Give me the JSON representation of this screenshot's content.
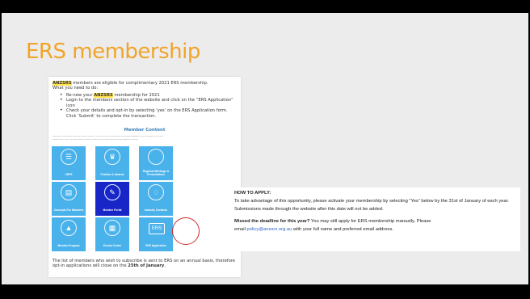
{
  "slide": {
    "title": "ERS membership"
  },
  "embedded": {
    "intro_org": "ANZSRS",
    "intro_rest": " members are eligible for complimentary 2021 ERS membership.",
    "intro_line2": "What you need to do:",
    "bullets": [
      {
        "pre": "Re-new your ",
        "org": "ANZSRS",
        "post": " membership for 2021"
      },
      {
        "text": "Login to the members section of the website and click on the “ERS Application” icon"
      },
      {
        "text": "Check your details and opt-in by selecting ‘yes’ on the ERS Application form. Click ‘Submit’ to complete the transaction."
      }
    ],
    "member_content_title": "Member Content",
    "member_content_lines": [
      "Welcome to the ANZSRS Member Content section. Here you will find resources and information available only to members of ANZSRS.",
      "Please click on one of the tiles below to access member-only content and services provided by ANZSRS."
    ],
    "tiles": [
      {
        "label": "CRFS",
        "icon": "document-icon",
        "glyph": "☰"
      },
      {
        "label": "Position & Awards",
        "icon": "award-icon",
        "glyph": "♛"
      },
      {
        "label": "Regional Meetings & Presentations",
        "icon": "speech-bubble-icon",
        "glyph": ""
      },
      {
        "label": "Concepts\nFor Members",
        "icon": "book-icon",
        "glyph": "▤"
      },
      {
        "label": "Member Portal",
        "icon": "pen-icon",
        "glyph": "✎"
      },
      {
        "label": "Industry Contacts",
        "icon": "lightbulb-icon",
        "glyph": "♢"
      },
      {
        "label": "Member Program",
        "icon": "graduation-cap-icon",
        "glyph": "▲"
      },
      {
        "label": "Events Centre",
        "icon": "calendar-icon",
        "glyph": "▦"
      },
      {
        "label": "ERS Application",
        "icon": "ers-logo-icon",
        "glyph": "ERS"
      }
    ],
    "outro": "The list of members who wish to subscribe is sent to ERS on an annual basis, therefore opt-in applications will close on the ",
    "outro_date": "25th of January",
    "outro_end": "."
  },
  "howto": {
    "heading": "HOW TO APPLY:",
    "body1": "To take advantage of this opportunity, please activate your membership by selecting “Yes” below by the 31st of January of each year. Submissions made through the website after this date will not be added.",
    "missed_bold": "Missed the deadline for this year?",
    "missed_rest": " You may still apply for ERS membership manually. Please",
    "email_pre": "email ",
    "email_link": "policy@anzsrs.org.au",
    "email_post": " with your full name and preferred email address."
  },
  "colors": {
    "title": "#f0a42a",
    "tile": "#4ab2ea",
    "tile_dark": "#1826c8",
    "ring": "#d02c2c",
    "highlight": "#ffe34d",
    "link": "#2a63c7"
  }
}
